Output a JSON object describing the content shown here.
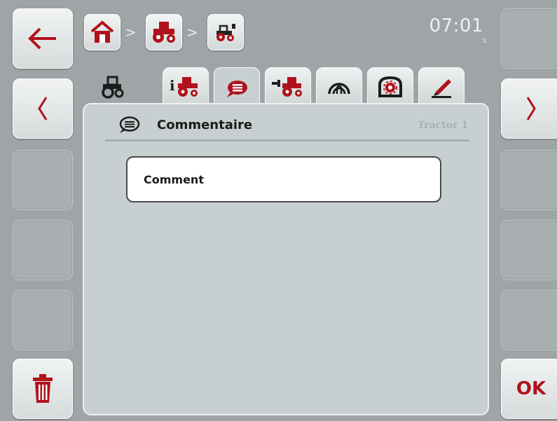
{
  "header": {
    "breadcrumb": [
      {
        "name": "home",
        "icon": "home-icon"
      },
      {
        "name": "tractor",
        "icon": "tractor-icon"
      },
      {
        "name": "tractor-detail",
        "icon": "tractor-small-icon"
      }
    ],
    "separator": ">",
    "time": "07:01",
    "time_sub": "3."
  },
  "tabs": [
    {
      "icon": "tractor-icon",
      "active": false
    },
    {
      "icon": "tractor-info-icon",
      "active": false
    },
    {
      "icon": "comment-icon",
      "active": true
    },
    {
      "icon": "tractor-connector-icon",
      "active": false
    },
    {
      "icon": "speed-gauge-icon",
      "active": false
    },
    {
      "icon": "engine-settings-icon",
      "active": false
    },
    {
      "icon": "edit-pen-icon",
      "active": false
    }
  ],
  "panel": {
    "title": "Commentaire",
    "subtitle": "Tractor 1",
    "field_label": "Comment"
  },
  "left_buttons": [
    {
      "icon": "back-arrow-icon"
    },
    {
      "icon": "previous-chevron-icon"
    },
    {
      "icon": ""
    },
    {
      "icon": ""
    },
    {
      "icon": ""
    },
    {
      "icon": "trash-icon"
    }
  ],
  "right_buttons": [
    {
      "icon": ""
    },
    {
      "icon": "next-chevron-icon"
    },
    {
      "icon": ""
    },
    {
      "icon": ""
    },
    {
      "icon": ""
    },
    {
      "label": "OK"
    }
  ],
  "colors": {
    "accent": "#b0121b",
    "background": "#9fa5a7",
    "panel": "#c8cfd0"
  }
}
